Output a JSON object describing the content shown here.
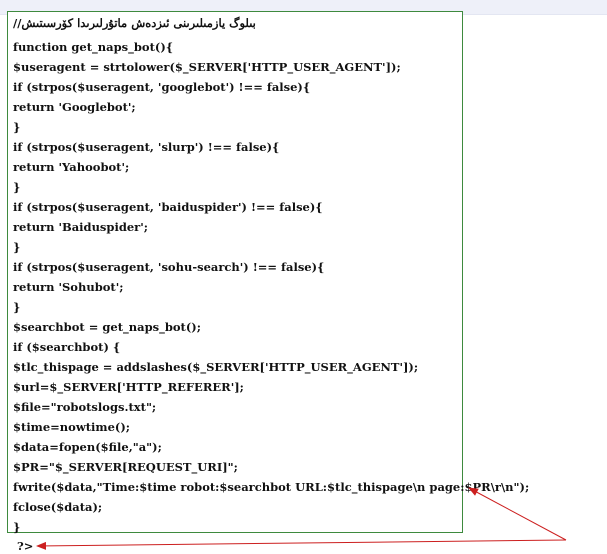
{
  "code": {
    "lines": [
      "بىلوگ يازمىلىرىنى ئىزدەش ماتۇرلىرىدا كۆرسىتىش//",
      "function get_naps_bot(){",
      "$useragent = strtolower($_SERVER['HTTP_USER_AGENT']);",
      "if (strpos($useragent, 'googlebot') !== false){",
      "return 'Googlebot';",
      "}",
      "if (strpos($useragent, 'slurp') !== false){",
      "return 'Yahoobot';",
      "}",
      "if (strpos($useragent, 'baiduspider') !== false){",
      "return 'Baiduspider';",
      "}",
      "if (strpos($useragent, 'sohu-search') !== false){",
      "return 'Sohubot';",
      "}",
      "$searchbot = get_naps_bot();",
      "if ($searchbot) {",
      "$tlc_thispage = addslashes($_SERVER['HTTP_USER_AGENT']);",
      "$url=$_SERVER['HTTP_REFERER'];",
      "$file=\"robotslogs.txt\";",
      "$time=nowtime();",
      "$data=fopen($file,\"a\");",
      "$PR=\"$_SERVER[REQUEST_URI]\";",
      "fwrite($data,\"Time:$time robot:$searchbot URL:$tlc_thispage\\n page:$PR\\r\\n\");",
      "fclose($data);",
      "}"
    ],
    "closing_tag": "?>"
  },
  "colors": {
    "box_border": "#3e8a3e",
    "arrow": "#cc1f1f",
    "text": "#111111"
  }
}
